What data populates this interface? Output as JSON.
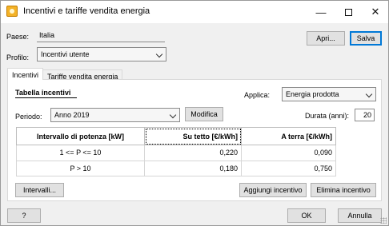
{
  "window": {
    "title": "Incentivi e tariffe vendita energia"
  },
  "paese": {
    "label": "Paese:",
    "value": "Italia"
  },
  "profilo": {
    "label": "Profilo:",
    "value": "Incentivi utente"
  },
  "buttons": {
    "apri": "Apri...",
    "salva": "Salva"
  },
  "tabs": [
    {
      "label": "Incentivi"
    },
    {
      "label": "Tariffe vendita energia"
    }
  ],
  "panel": {
    "section_title": "Tabella incentivi",
    "applica_label": "Applica:",
    "applica_value": "Energia prodotta",
    "periodo_label": "Periodo:",
    "periodo_value": "Anno 2019",
    "modifica": "Modifica",
    "durata_label": "Durata (anni):",
    "durata_value": "20",
    "table": {
      "headers": [
        "Intervallo di potenza [kW]",
        "Su tetto [€/kWh]",
        "A terra [€/kWh]"
      ],
      "rows": [
        [
          "1 <= P <= 10",
          "0,220",
          "0,090"
        ],
        [
          "P > 10",
          "0,180",
          "0,750"
        ]
      ]
    },
    "intervalli": "Intervalli...",
    "aggiungi": "Aggiungi incentivo",
    "elimina": "Elimina incentivo"
  },
  "footer": {
    "help": "?",
    "ok": "OK",
    "annulla": "Annulla"
  }
}
